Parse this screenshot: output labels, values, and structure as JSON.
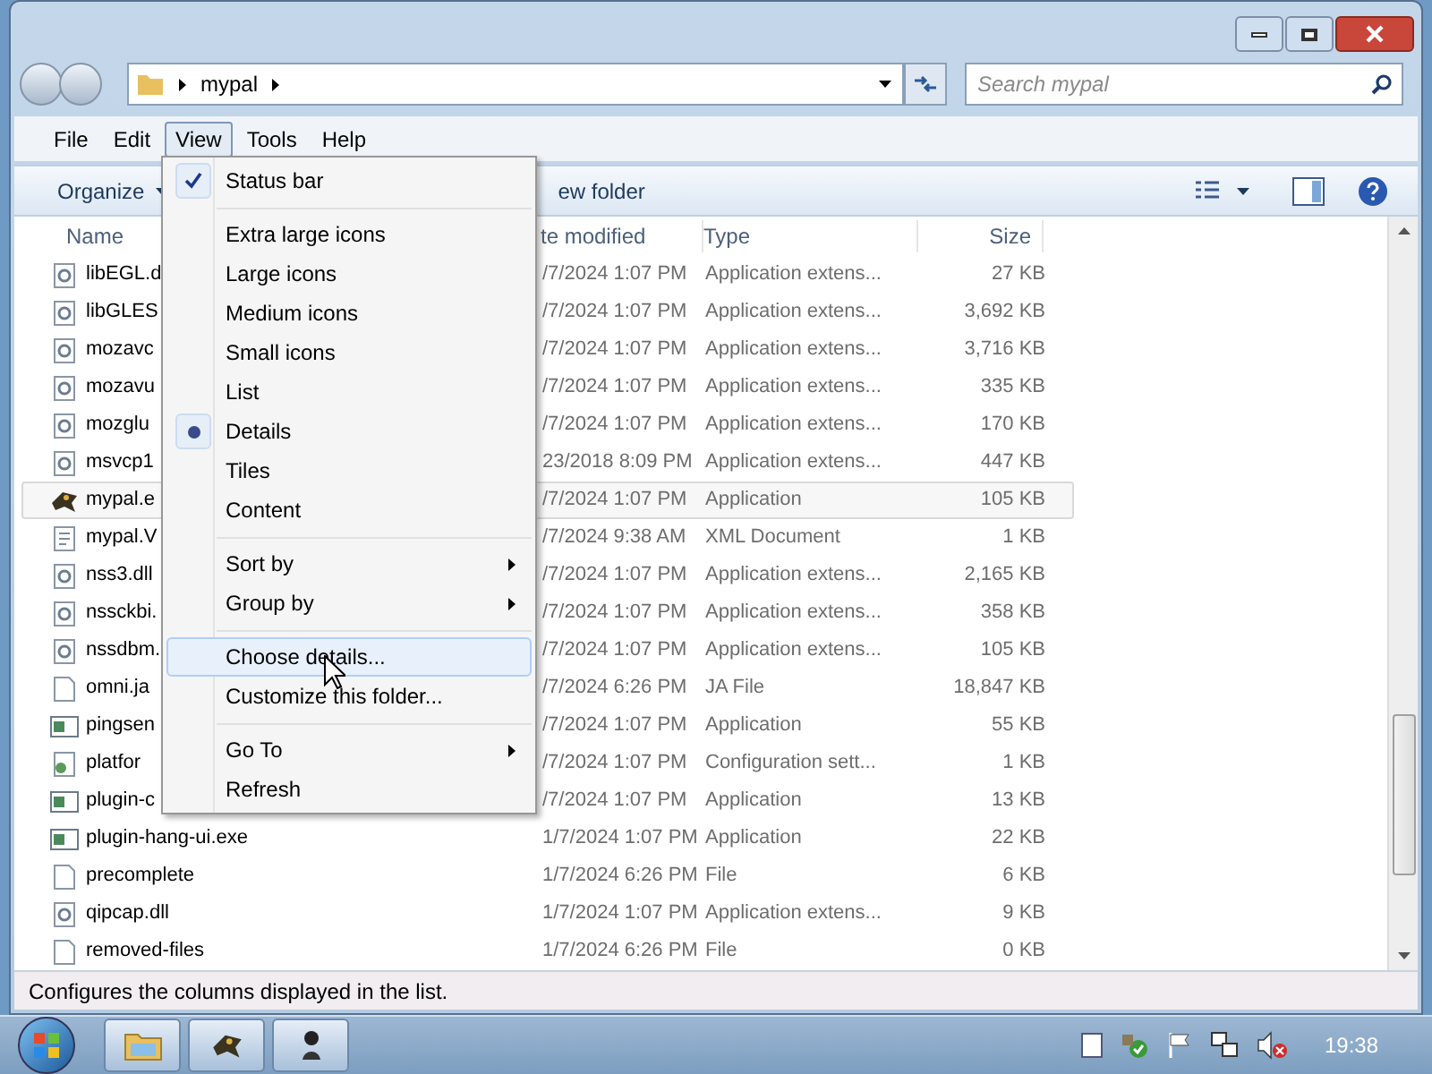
{
  "address": {
    "crumb": "mypal",
    "search_placeholder": "Search mypal"
  },
  "menubar": [
    {
      "label": "File",
      "selected": false
    },
    {
      "label": "Edit",
      "selected": false
    },
    {
      "label": "View",
      "selected": true
    },
    {
      "label": "Tools",
      "selected": false
    },
    {
      "label": "Help",
      "selected": false
    }
  ],
  "toolbar": {
    "organize": "Organize",
    "new_folder": "ew folder"
  },
  "columns": [
    "Name",
    "te modified",
    "Type",
    "Size"
  ],
  "rows": [
    {
      "name": "libEGL.d",
      "date": "/7/2024 1:07 PM",
      "type": "Application extens...",
      "size": "27 KB",
      "kind": "dll",
      "selected": false
    },
    {
      "name": "libGLES",
      "date": "/7/2024 1:07 PM",
      "type": "Application extens...",
      "size": "3,692 KB",
      "kind": "dll",
      "selected": false
    },
    {
      "name": "mozavc",
      "date": "/7/2024 1:07 PM",
      "type": "Application extens...",
      "size": "3,716 KB",
      "kind": "dll",
      "selected": false
    },
    {
      "name": "mozavu",
      "date": "/7/2024 1:07 PM",
      "type": "Application extens...",
      "size": "335 KB",
      "kind": "dll",
      "selected": false
    },
    {
      "name": "mozglu",
      "date": "/7/2024 1:07 PM",
      "type": "Application extens...",
      "size": "170 KB",
      "kind": "dll",
      "selected": false
    },
    {
      "name": "msvcp1",
      "date": "23/2018 8:09 PM",
      "type": "Application extens...",
      "size": "447 KB",
      "kind": "dll",
      "selected": false
    },
    {
      "name": "mypal.e",
      "date": "/7/2024 1:07 PM",
      "type": "Application",
      "size": "105 KB",
      "kind": "mascot",
      "selected": true
    },
    {
      "name": "mypal.V",
      "date": "/7/2024 9:38 AM",
      "type": "XML Document",
      "size": "1 KB",
      "kind": "xml",
      "selected": false
    },
    {
      "name": "nss3.dll",
      "date": "/7/2024 1:07 PM",
      "type": "Application extens...",
      "size": "2,165 KB",
      "kind": "dll",
      "selected": false
    },
    {
      "name": "nssckbi.",
      "date": "/7/2024 1:07 PM",
      "type": "Application extens...",
      "size": "358 KB",
      "kind": "dll",
      "selected": false
    },
    {
      "name": "nssdbm.",
      "date": "/7/2024 1:07 PM",
      "type": "Application extens...",
      "size": "105 KB",
      "kind": "dll",
      "selected": false
    },
    {
      "name": "omni.ja",
      "date": "/7/2024 6:26 PM",
      "type": "JA File",
      "size": "18,847 KB",
      "kind": "blank",
      "selected": false
    },
    {
      "name": "pingsen",
      "date": "/7/2024 1:07 PM",
      "type": "Application",
      "size": "55 KB",
      "kind": "app",
      "selected": false
    },
    {
      "name": "platfor",
      "date": "/7/2024 1:07 PM",
      "type": "Configuration sett...",
      "size": "1 KB",
      "kind": "config",
      "selected": false
    },
    {
      "name": "plugin-c",
      "date": "/7/2024 1:07 PM",
      "type": "Application",
      "size": "13 KB",
      "kind": "app",
      "selected": false
    },
    {
      "name": "plugin-hang-ui.exe",
      "date": "1/7/2024 1:07 PM",
      "type": "Application",
      "size": "22 KB",
      "kind": "app",
      "selected": false
    },
    {
      "name": "precomplete",
      "date": "1/7/2024 6:26 PM",
      "type": "File",
      "size": "6 KB",
      "kind": "blank",
      "selected": false
    },
    {
      "name": "qipcap.dll",
      "date": "1/7/2024 1:07 PM",
      "type": "Application extens...",
      "size": "9 KB",
      "kind": "dll",
      "selected": false
    },
    {
      "name": "removed-files",
      "date": "1/7/2024 6:26 PM",
      "type": "File",
      "size": "0 KB",
      "kind": "blank",
      "selected": false
    }
  ],
  "view_menu": [
    {
      "kind": "check",
      "label": "Status bar",
      "checked": true,
      "selected": false
    },
    {
      "kind": "separator"
    },
    {
      "kind": "radio",
      "label": "Extra large icons",
      "checked": false,
      "selected": false
    },
    {
      "kind": "radio",
      "label": "Large icons",
      "checked": false,
      "selected": false
    },
    {
      "kind": "radio",
      "label": "Medium icons",
      "checked": false,
      "selected": false
    },
    {
      "kind": "radio",
      "label": "Small icons",
      "checked": false,
      "selected": false
    },
    {
      "kind": "radio",
      "label": "List",
      "checked": false,
      "selected": false
    },
    {
      "kind": "radio",
      "label": "Details",
      "checked": true,
      "selected": false
    },
    {
      "kind": "radio",
      "label": "Tiles",
      "checked": false,
      "selected": false
    },
    {
      "kind": "radio",
      "label": "Content",
      "checked": false,
      "selected": false
    },
    {
      "kind": "separator"
    },
    {
      "kind": "submenu",
      "label": "Sort by",
      "selected": false
    },
    {
      "kind": "submenu",
      "label": "Group by",
      "selected": false
    },
    {
      "kind": "separator"
    },
    {
      "kind": "item",
      "label": "Choose details...",
      "selected": true
    },
    {
      "kind": "item",
      "label": "Customize this folder...",
      "selected": false
    },
    {
      "kind": "separator"
    },
    {
      "kind": "submenu",
      "label": "Go To",
      "selected": false
    },
    {
      "kind": "item",
      "label": "Refresh",
      "selected": false
    }
  ],
  "status_bar": "Configures the columns displayed in the list.",
  "taskbar": {
    "clock": "19:38"
  }
}
